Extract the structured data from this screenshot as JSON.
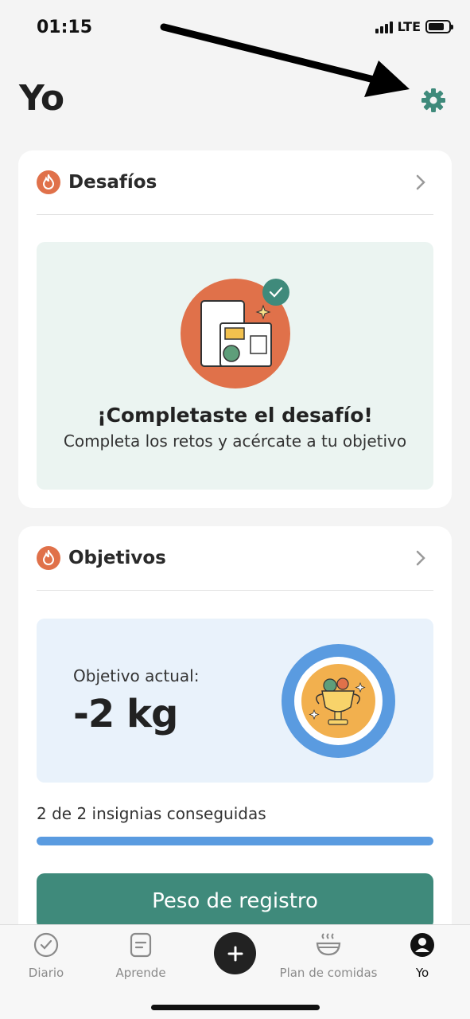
{
  "status_bar": {
    "time": "01:15",
    "network": "LTE",
    "battery_level": 0.8
  },
  "header": {
    "title": "Yo",
    "settings_icon": "gear-icon"
  },
  "colors": {
    "accent": "#3f8a7b",
    "flame": "#e0714a",
    "blue": "#5a9be0",
    "trophy": "#f2b04e"
  },
  "challenges": {
    "title": "Desafíos",
    "icon": "flame-icon",
    "completed_title": "¡Completaste el desafío!",
    "completed_subtitle": "Completa los retos y acércate a tu objetivo"
  },
  "goals": {
    "title": "Objetivos",
    "icon": "flame-icon",
    "current_label": "Objetivo actual:",
    "current_value": "-2 kg",
    "badges_text": "2 de 2 insignias conseguidas",
    "badges_progress": 1.0,
    "button_label": "Peso de registro"
  },
  "tab_bar": {
    "items": [
      {
        "label": "Diario",
        "icon": "check-circle-icon"
      },
      {
        "label": "Aprende",
        "icon": "document-icon"
      },
      {
        "label": "",
        "icon": "plus-icon"
      },
      {
        "label": "Plan de comidas",
        "icon": "bowl-icon"
      },
      {
        "label": "Yo",
        "icon": "profile-icon",
        "active": true
      }
    ]
  }
}
